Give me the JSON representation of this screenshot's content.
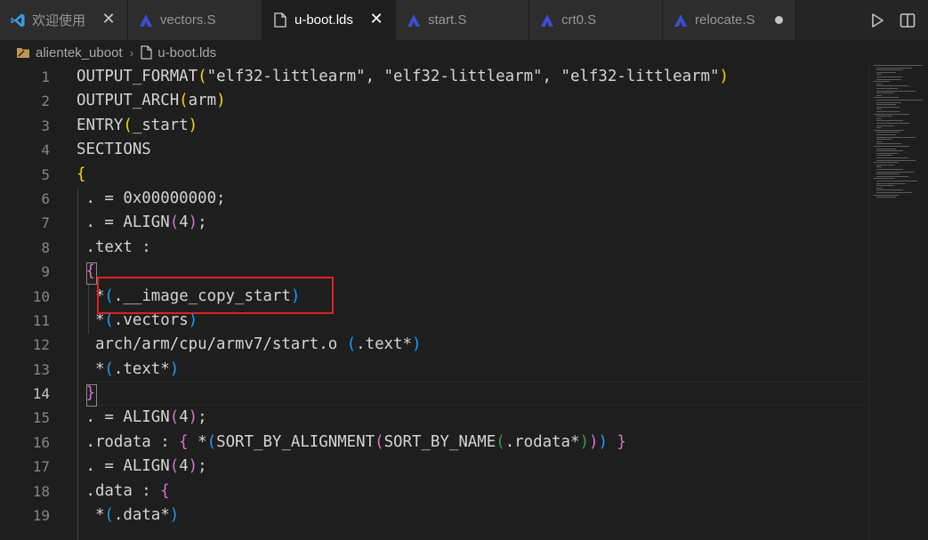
{
  "tabs": [
    {
      "label": "欢迎使用",
      "icon": "vscode-logo-icon",
      "state": "close",
      "active": false
    },
    {
      "label": "vectors.S",
      "icon": "assembly-file-icon",
      "state": "none",
      "active": false
    },
    {
      "label": "u-boot.lds",
      "icon": "file-icon",
      "state": "close",
      "active": true
    },
    {
      "label": "start.S",
      "icon": "assembly-file-icon",
      "state": "none",
      "active": false
    },
    {
      "label": "crt0.S",
      "icon": "assembly-file-icon",
      "state": "none",
      "active": false
    },
    {
      "label": "relocate.S",
      "icon": "assembly-file-icon",
      "state": "dirty",
      "active": false
    }
  ],
  "tab_actions": [
    "run-icon",
    "split-editor-icon"
  ],
  "breadcrumb": {
    "folder": "alientek_uboot",
    "file": "u-boot.lds"
  },
  "editor": {
    "current_line": 14,
    "line_numbers": [
      "1",
      "2",
      "3",
      "4",
      "5",
      "6",
      "7",
      "8",
      "9",
      "10",
      "11",
      "12",
      "13",
      "14",
      "15",
      "16",
      "17",
      "18",
      "19"
    ]
  },
  "colors": {
    "bracket_level1": "#ffd700",
    "bracket_level2": "#da70d6",
    "bracket_level3": "#179fff",
    "bracket_level4": "#3c9a4a",
    "annotation_box": "#e02020",
    "asm_icon": "#3a4fd8"
  }
}
